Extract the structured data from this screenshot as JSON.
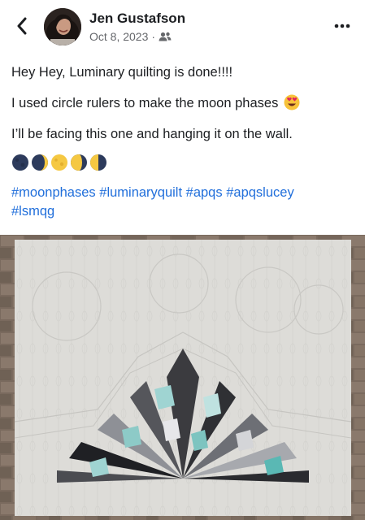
{
  "post": {
    "author": "Jen Gustafson",
    "date": "Oct 8, 2023",
    "separator": "·",
    "audience_icon": "friends-icon",
    "lines": [
      "Hey Hey, Luminary quilting is done!!!!",
      "I used circle rulers to make the moon phases",
      "I’ll be facing this one and hanging it on the wall."
    ],
    "emoji_after_line2": "heart-eyes-emoji",
    "moon_emojis": [
      "new-moon",
      "waxing-crescent",
      "full-moon",
      "waning-gibbous",
      "last-quarter"
    ],
    "hashtags": [
      "#moonphases",
      "#luminaryquilt",
      "#apqs",
      "#apqslucey",
      "#lsmqg"
    ]
  },
  "colors": {
    "text": "#1c1e21",
    "secondary_text": "#65676b",
    "link": "#216fdb",
    "quilt_background": "#dcdbd7",
    "brick": "#7a6a5e"
  }
}
